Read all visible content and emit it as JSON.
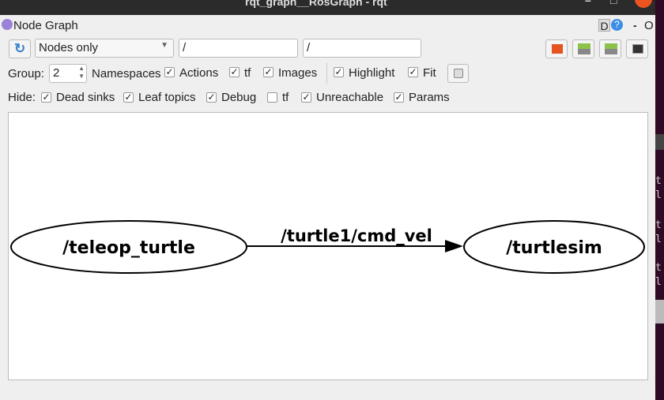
{
  "window": {
    "title": "rqt_graph__RosGraph - rqt"
  },
  "dock": {
    "title": "Node Graph",
    "d_label": "D",
    "help_label": "?",
    "minimize_label": "-",
    "float_label": "O"
  },
  "toolbar": {
    "mode": "Nodes only",
    "node_filter": "/",
    "topic_filter": "/"
  },
  "row2": {
    "group_label": "Group:",
    "group_value": "2",
    "namespaces": "Namespaces",
    "checks": [
      {
        "label": "Actions",
        "checked": true
      },
      {
        "label": "tf",
        "checked": true
      },
      {
        "label": "Images",
        "checked": true
      },
      {
        "label": "Highlight",
        "checked": true
      },
      {
        "label": "Fit",
        "checked": true
      }
    ]
  },
  "row3": {
    "hide_label": "Hide:",
    "checks": [
      {
        "label": "Dead sinks",
        "checked": true
      },
      {
        "label": "Leaf topics",
        "checked": true
      },
      {
        "label": "Debug",
        "checked": true
      },
      {
        "label": "tf",
        "checked": false
      },
      {
        "label": "Unreachable",
        "checked": true
      },
      {
        "label": "Params",
        "checked": true
      }
    ]
  },
  "graph": {
    "nodes": [
      "/teleop_turtle",
      "/turtlesim"
    ],
    "edge_label": "/turtle1/cmd_vel"
  },
  "terminal": {
    "lines": [
      "t",
      "l",
      "t",
      "l",
      "t",
      "l"
    ]
  }
}
